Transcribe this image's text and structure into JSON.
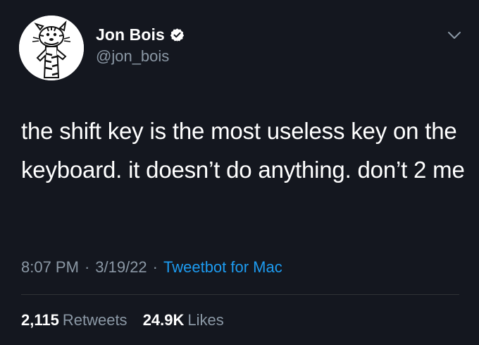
{
  "author": {
    "display_name": "Jon Bois",
    "handle": "@jon_bois",
    "verified_icon": "verified-badge-icon",
    "avatar_icon": "cartoon-tiger-avatar"
  },
  "menu_icon": "chevron-down-icon",
  "tweet": {
    "text": "the shift key is the most useless key on the keyboard. it doesn’t do anything. don’t 2 me",
    "time": "8:07 PM",
    "date": "3/19/22",
    "separator": "·",
    "source": "Tweetbot for Mac"
  },
  "stats": {
    "retweets_count": "2,115",
    "retweets_label": "Retweets",
    "likes_count": "24.9K",
    "likes_label": "Likes"
  },
  "colors": {
    "background": "#14171f",
    "text": "#ffffff",
    "muted": "#8b98a5",
    "link": "#1d9bf0",
    "divider": "#2f3336"
  }
}
